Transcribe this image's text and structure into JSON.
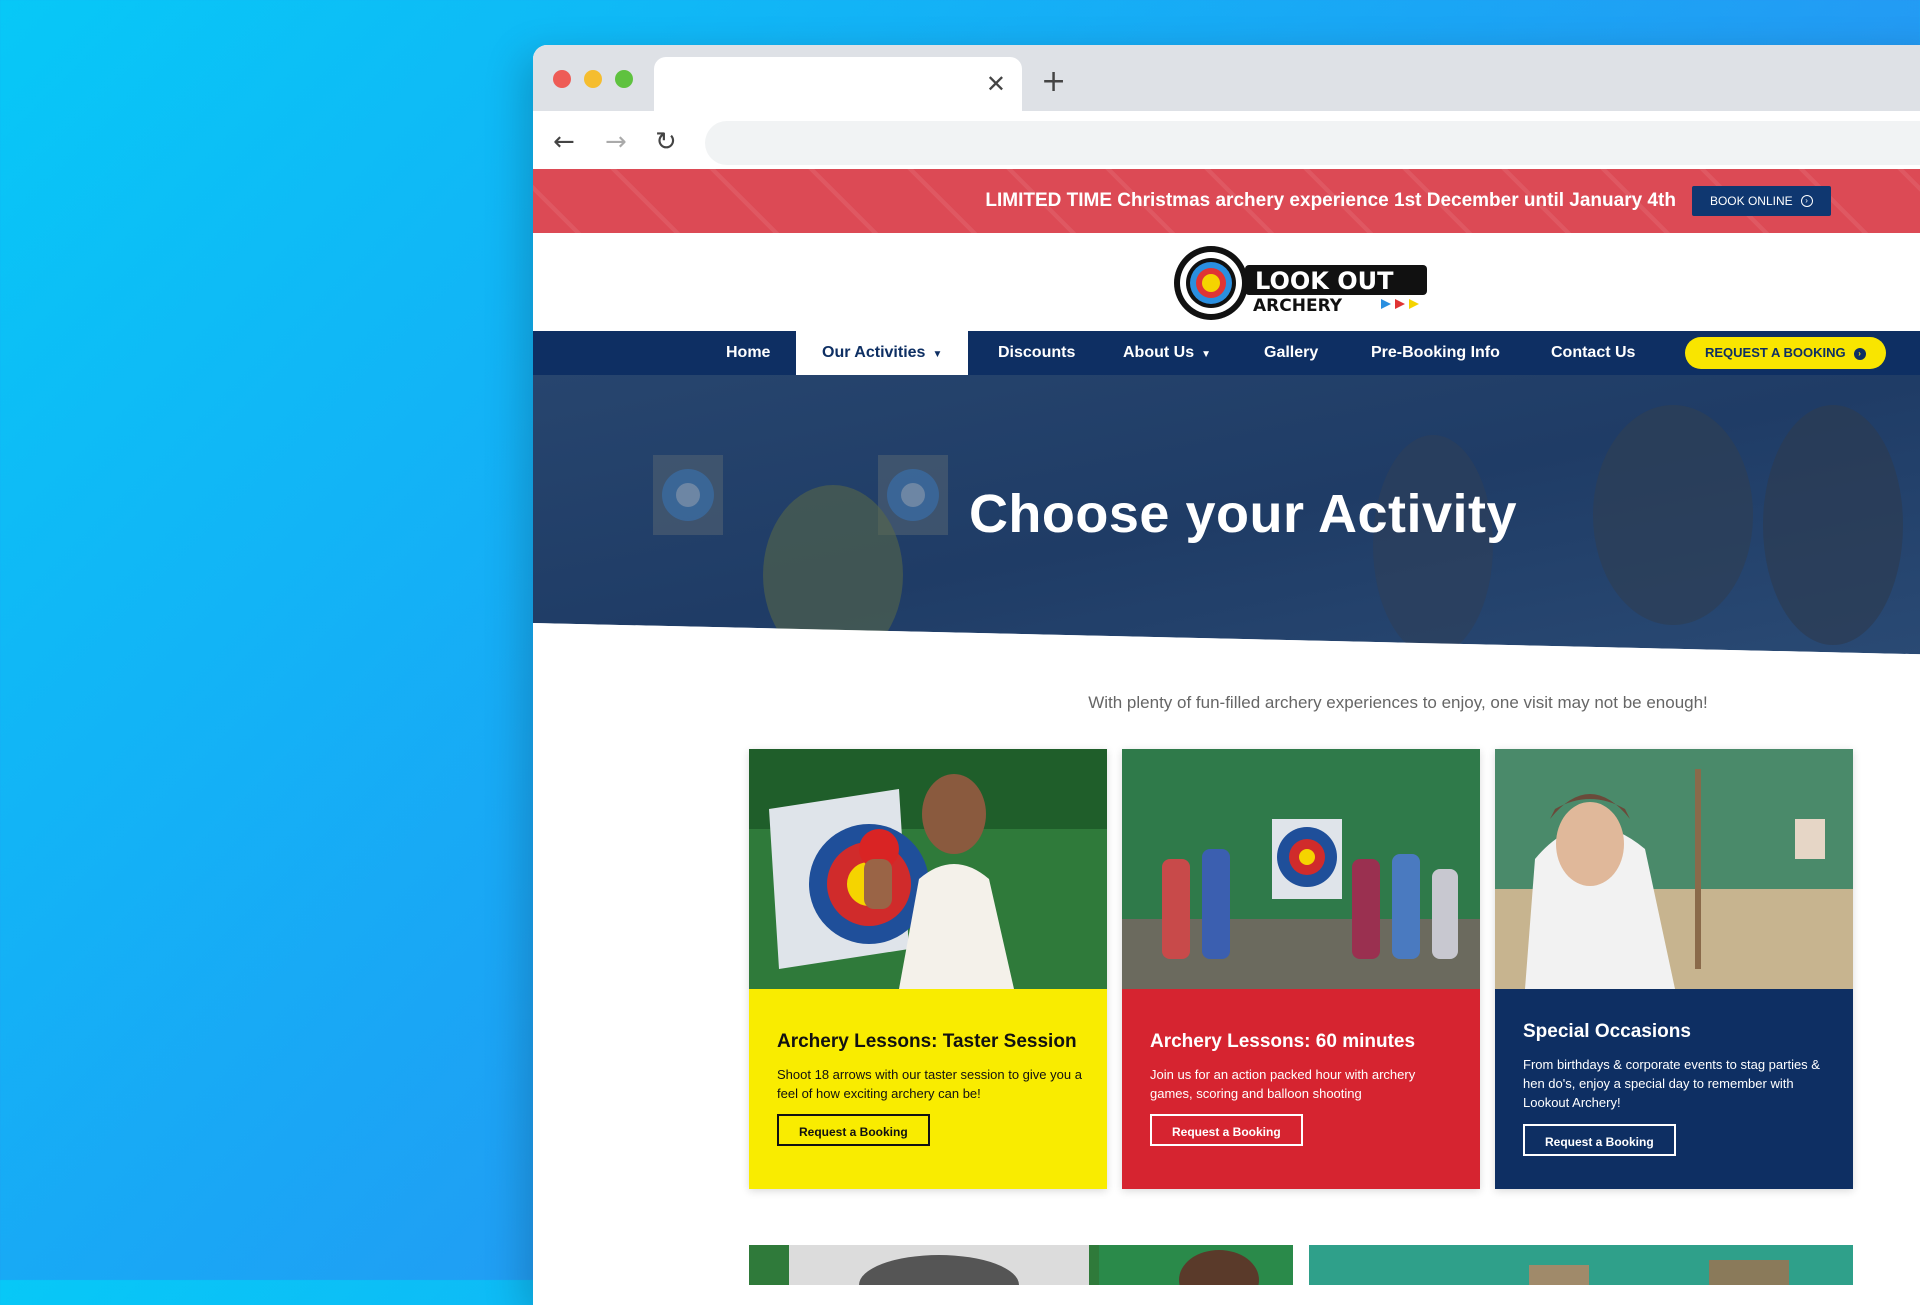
{
  "browser": {
    "tab_close_icon": "close-icon",
    "new_tab_icon": "plus-icon",
    "back_icon": "arrow-left-icon",
    "forward_icon": "arrow-right-icon",
    "reload_icon": "reload-icon"
  },
  "promo": {
    "text": "LIMITED TIME Christmas archery experience 1st December until January 4th",
    "button_label": "BOOK ONLINE"
  },
  "logo": {
    "line1": "LOOK OUT",
    "line2": "ARCHERY"
  },
  "nav": {
    "items": [
      {
        "label": "Home"
      },
      {
        "label": "Our Activities",
        "dropdown": true
      },
      {
        "label": "Discounts"
      },
      {
        "label": "About Us",
        "dropdown": true
      },
      {
        "label": "Gallery"
      },
      {
        "label": "Pre-Booking Info"
      },
      {
        "label": "Contact Us"
      }
    ],
    "cta": "REQUEST A BOOKING"
  },
  "hero": {
    "title": "Choose your Activity"
  },
  "intro": "With plenty of fun-filled archery experiences to enjoy, one visit may not be enough!",
  "cards": [
    {
      "title": "Archery Lessons: Taster Session",
      "text": "Shoot 18 arrows with our taster session to give you a feel of how exciting archery can be!",
      "button": "Request a Booking"
    },
    {
      "title": "Archery Lessons: 60 minutes",
      "text": "Join us for an action packed hour with archery games, scoring and balloon shooting",
      "button": "Request a Booking"
    },
    {
      "title": "Special Occasions",
      "text": "From birthdays & corporate events to stag parties & hen do's, enjoy a special day to remember with Lookout Archery!",
      "button": "Request a Booking"
    }
  ],
  "colors": {
    "navy": "#0e2f63",
    "promo_red": "#dc4a55",
    "cta_yellow": "#f9e500",
    "card_yellow": "#f9ec00",
    "card_red": "#d62430"
  }
}
